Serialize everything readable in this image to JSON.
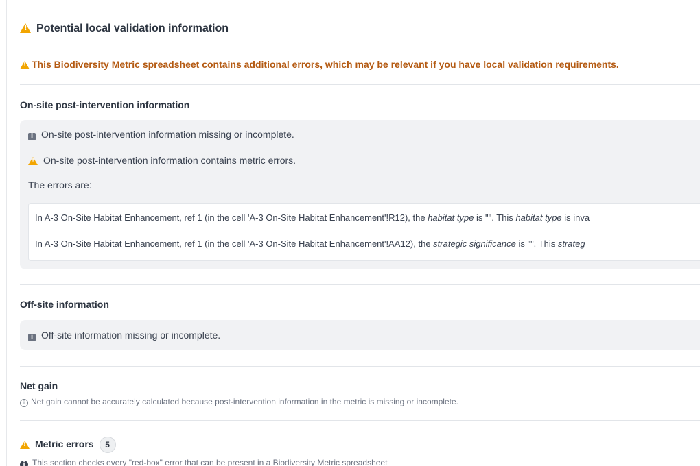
{
  "header": {
    "title": "Potential local validation information",
    "banner": "This Biodiversity Metric spreadsheet contains additional errors, which may be relevant if you have local validation requirements."
  },
  "onsite": {
    "title": "On-site post-intervention information",
    "missing": "On-site post-intervention information missing or incomplete.",
    "metric_errors": "On-site post-intervention information contains metric errors.",
    "errors_intro": "The errors are:",
    "errors": [
      {
        "prefix": "In A-3 On-Site Habitat Enhancement, ref 1 (in the cell 'A-3 On-Site Habitat Enhancement'!R12), the ",
        "field": "habitat type",
        "middle": " is \"\". This ",
        "field2": "habitat type",
        "suffix": " is inva"
      },
      {
        "prefix": "In A-3 On-Site Habitat Enhancement, ref 1 (in the cell 'A-3 On-Site Habitat Enhancement'!AA12), the ",
        "field": "strategic significance",
        "middle": " is \"\". This ",
        "field2": "strateg",
        "suffix": ""
      }
    ]
  },
  "offsite": {
    "title": "Off-site information",
    "missing": "Off-site information missing or incomplete."
  },
  "netgain": {
    "title": "Net gain",
    "note": "Net gain cannot be accurately calculated because post-intervention information in the metric is missing or incomplete."
  },
  "metric_errors": {
    "title": "Metric errors",
    "count": "5",
    "note": "This section checks every \"red-box\" error that can be present in a Biodiversity Metric spreadsheet"
  },
  "icons": {
    "warning": "warning-triangle-icon",
    "info_square": "info-square-icon",
    "info_circle": "info-circle-icon"
  },
  "colors": {
    "warning": "#f2a500",
    "banner_text": "#b45a12",
    "box_bg": "#f1f2f4"
  }
}
